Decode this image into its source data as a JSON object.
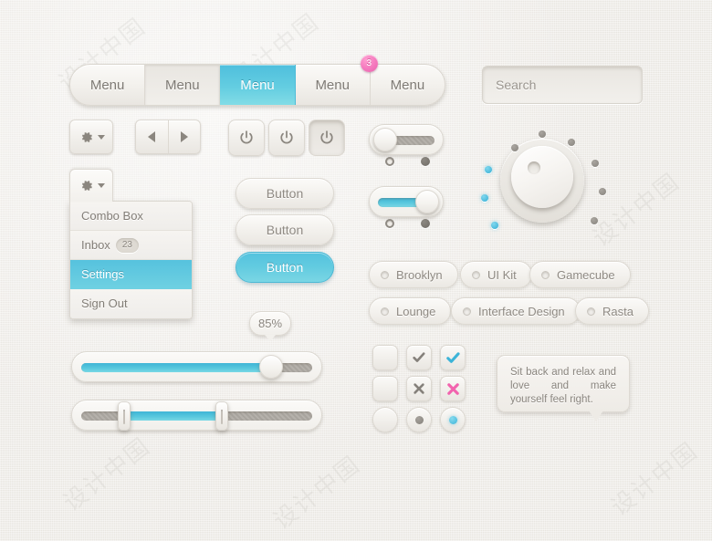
{
  "menu": {
    "items": [
      {
        "label": "Menu",
        "state": "normal"
      },
      {
        "label": "Menu",
        "state": "hover"
      },
      {
        "label": "Menu",
        "state": "active"
      },
      {
        "label": "Menu",
        "state": "normal",
        "badge": "3"
      },
      {
        "label": "Menu",
        "state": "normal"
      }
    ]
  },
  "search": {
    "value": "",
    "placeholder": "Search",
    "icon": "search-icon"
  },
  "toolbar": {
    "gear_icon": "gear-icon",
    "caret_icon": "chevron-down-icon",
    "prev_icon": "triangle-left-icon",
    "next_icon": "triangle-right-icon",
    "power_icon": "power-icon",
    "power_buttons": [
      "normal",
      "normal",
      "pressed"
    ]
  },
  "dropdown": {
    "trigger_icon": "gear-icon",
    "items": [
      {
        "label": "Combo Box",
        "selected": false
      },
      {
        "label": "Inbox",
        "count": "23",
        "selected": false
      },
      {
        "label": "Settings",
        "selected": true
      },
      {
        "label": "Sign Out",
        "selected": false
      }
    ]
  },
  "buttons": [
    {
      "label": "Button",
      "style": "default"
    },
    {
      "label": "Button",
      "style": "raised"
    },
    {
      "label": "Button",
      "style": "primary"
    }
  ],
  "toggles": [
    {
      "state": "off",
      "dots": [
        "hollow",
        "solid"
      ]
    },
    {
      "state": "on",
      "dots": [
        "hollow",
        "solid"
      ]
    }
  ],
  "knob": {
    "name": "rotary-knob",
    "dots": [
      "blue",
      "blue",
      "blue",
      "gray",
      "gray",
      "gray",
      "gray",
      "gray",
      "gray"
    ]
  },
  "tags": [
    {
      "label": "Brooklyn"
    },
    {
      "label": "UI Kit"
    },
    {
      "label": "Gamecube"
    },
    {
      "label": "Lounge"
    },
    {
      "label": "Interface Design"
    },
    {
      "label": "Rasta"
    }
  ],
  "slider": {
    "value_label": "85%",
    "fill_percent": 80
  },
  "range_slider": {
    "low_percent": 18,
    "high_percent": 58
  },
  "check_grid": {
    "rows": [
      [
        {
          "type": "checkbox",
          "state": "empty"
        },
        {
          "type": "checkbox",
          "state": "check-gray"
        },
        {
          "type": "checkbox",
          "state": "check-blue"
        }
      ],
      [
        {
          "type": "checkbox",
          "state": "empty"
        },
        {
          "type": "checkbox",
          "state": "cross-gray"
        },
        {
          "type": "checkbox",
          "state": "cross-pink"
        }
      ],
      [
        {
          "type": "radio",
          "state": "empty"
        },
        {
          "type": "radio",
          "state": "dot-gray"
        },
        {
          "type": "radio",
          "state": "dot-blue"
        }
      ]
    ]
  },
  "tooltip": {
    "text": "Sit back and relax and love and make yourself feel right."
  },
  "colors": {
    "accent_blue": "#56c2de",
    "accent_pink": "#f478bd",
    "background": "#eeebe6",
    "text_gray": "#8a857e"
  },
  "watermarks": [
    "设计中国",
    "设计中国",
    "设计中国",
    "设计中国",
    "设计中国",
    "设计中国"
  ]
}
